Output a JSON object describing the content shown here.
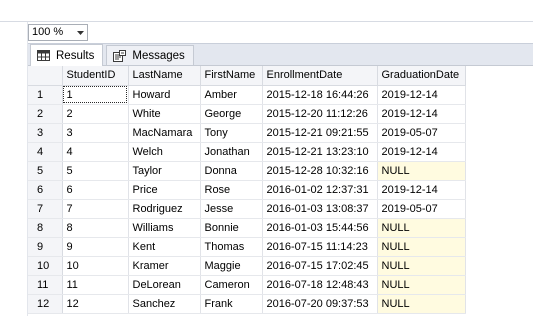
{
  "zoom": {
    "value": "100 %"
  },
  "tabs": [
    {
      "label": "Results",
      "icon": "grid-icon"
    },
    {
      "label": "Messages",
      "icon": "messages-icon"
    }
  ],
  "grid": {
    "columns": [
      "StudentID",
      "LastName",
      "FirstName",
      "EnrollmentDate",
      "GraduationDate"
    ],
    "rows": [
      [
        "1",
        "1",
        "Howard",
        "Amber",
        "2015-12-18 16:44:26",
        "2019-12-14"
      ],
      [
        "2",
        "2",
        "White",
        "George",
        "2015-12-20 11:12:26",
        "2019-12-14"
      ],
      [
        "3",
        "3",
        "MacNamara",
        "Tony",
        "2015-12-21 09:21:55",
        "2019-05-07"
      ],
      [
        "4",
        "4",
        "Welch",
        "Jonathan",
        "2015-12-21 13:23:10",
        "2019-12-14"
      ],
      [
        "5",
        "5",
        "Taylor",
        "Donna",
        "2015-12-28 10:32:16",
        "NULL"
      ],
      [
        "6",
        "6",
        "Price",
        "Rose",
        "2016-01-02 12:37:31",
        "2019-12-14"
      ],
      [
        "7",
        "7",
        "Rodriguez",
        "Jesse",
        "2016-01-03 13:08:37",
        "2019-05-07"
      ],
      [
        "8",
        "8",
        "Williams",
        "Bonnie",
        "2016-01-03 15:44:56",
        "NULL"
      ],
      [
        "9",
        "9",
        "Kent",
        "Thomas",
        "2016-07-15 11:14:23",
        "NULL"
      ],
      [
        "10",
        "10",
        "Kramer",
        "Maggie",
        "2016-07-15 17:02:45",
        "NULL"
      ],
      [
        "11",
        "11",
        "DeLorean",
        "Cameron",
        "2016-07-18 12:48:43",
        "NULL"
      ],
      [
        "12",
        "12",
        "Sanchez",
        "Frank",
        "2016-07-20 09:37:53",
        "NULL"
      ]
    ]
  },
  "colors": {
    "null_highlight": "#fffbe0",
    "header_bg": "#f4f5f8",
    "pane_bg": "#eef0f5"
  }
}
